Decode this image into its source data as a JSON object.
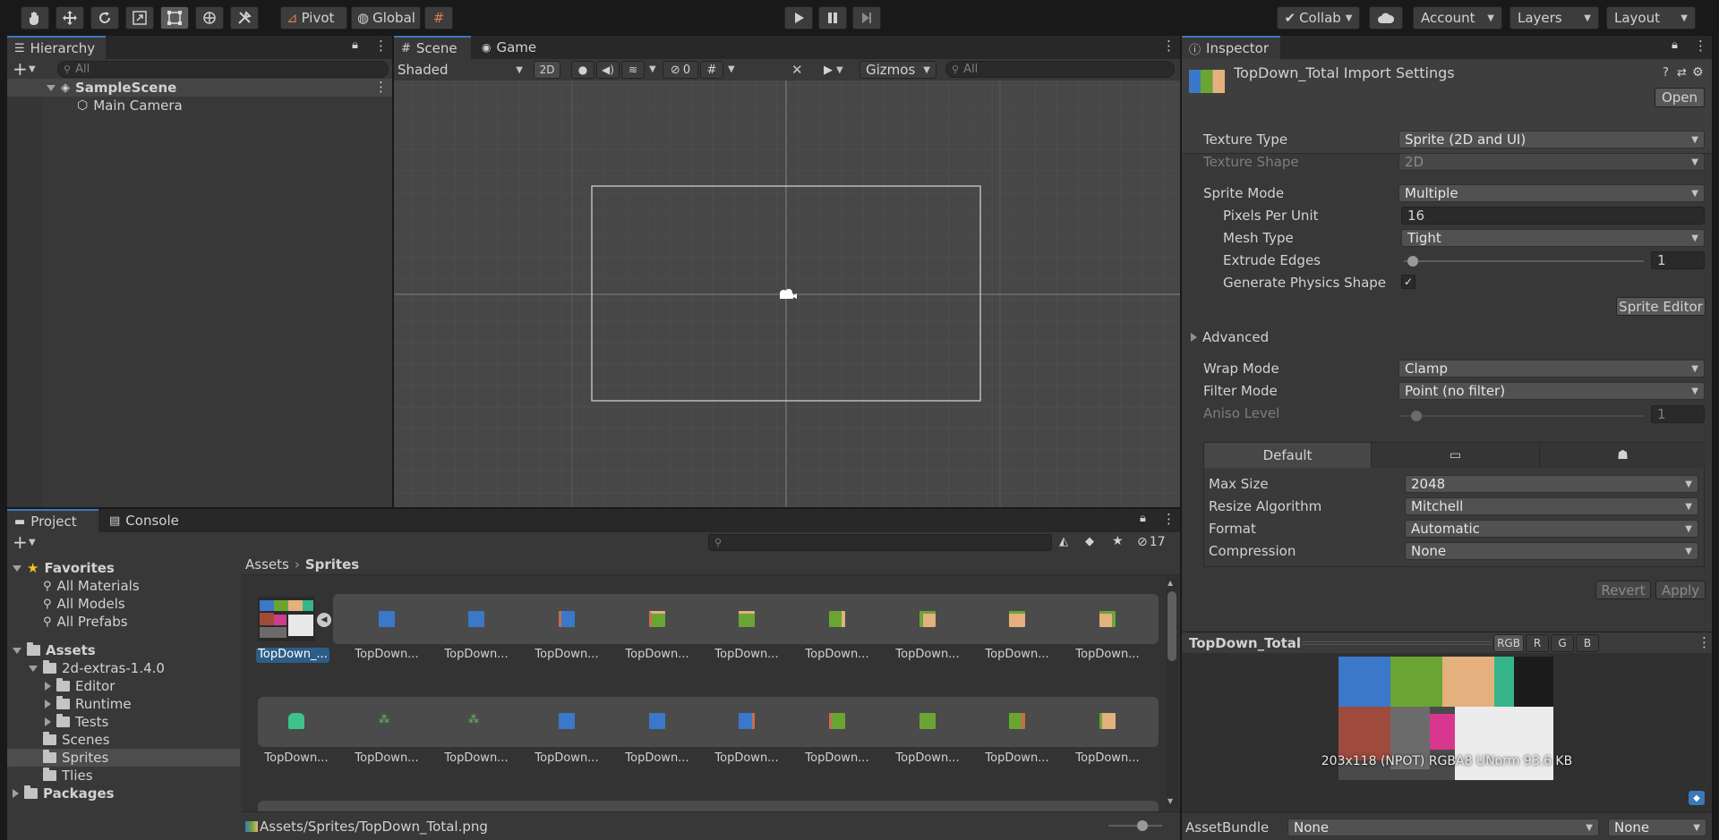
{
  "toolbar": {
    "pivot_label": "Pivot",
    "global_label": "Global",
    "collab_label": "Collab",
    "account_label": "Account",
    "layers_label": "Layers",
    "layout_label": "Layout"
  },
  "hierarchy": {
    "tab_label": "Hierarchy",
    "search_placeholder": "All",
    "scene_name": "SampleScene",
    "items": [
      "Main Camera"
    ]
  },
  "scene_view": {
    "tab_scene": "Scene",
    "tab_game": "Game",
    "shading_mode": "Shaded",
    "mode_2d": "2D",
    "hidden_count": "0",
    "gizmos_label": "Gizmos",
    "search_placeholder": "All"
  },
  "project": {
    "tab_project": "Project",
    "tab_console": "Console",
    "hidden_count": "17",
    "favorites_label": "Favorites",
    "favorites": [
      "All Materials",
      "All Models",
      "All Prefabs"
    ],
    "assets_label": "Assets",
    "folders": [
      "2d-extras-1.4.0",
      "Editor",
      "Runtime",
      "Tests",
      "Scenes",
      "Sprites",
      "Tlies"
    ],
    "packages_label": "Packages",
    "breadcrumb_root": "Assets",
    "breadcrumb_current": "Sprites",
    "selected_asset_label": "TopDown_...",
    "sprite_label": "TopDown...",
    "status_path": "Assets/Sprites/TopDown_Total.png"
  },
  "inspector": {
    "tab_label": "Inspector",
    "title": "TopDown_Total Import Settings",
    "open_label": "Open",
    "texture_type_label": "Texture Type",
    "texture_type_value": "Sprite (2D and UI)",
    "texture_shape_label": "Texture Shape",
    "texture_shape_value": "2D",
    "sprite_mode_label": "Sprite Mode",
    "sprite_mode_value": "Multiple",
    "ppu_label": "Pixels Per Unit",
    "ppu_value": "16",
    "mesh_type_label": "Mesh Type",
    "mesh_type_value": "Tight",
    "extrude_label": "Extrude Edges",
    "extrude_value": "1",
    "gen_physics_label": "Generate Physics Shape",
    "sprite_editor_label": "Sprite Editor",
    "advanced_label": "Advanced",
    "wrap_mode_label": "Wrap Mode",
    "wrap_mode_value": "Clamp",
    "filter_mode_label": "Filter Mode",
    "filter_mode_value": "Point (no filter)",
    "aniso_label": "Aniso Level",
    "aniso_value": "1",
    "platform_default": "Default",
    "max_size_label": "Max Size",
    "max_size_value": "2048",
    "resize_label": "Resize Algorithm",
    "resize_value": "Mitchell",
    "format_label": "Format",
    "format_value": "Automatic",
    "compression_label": "Compression",
    "compression_value": "None",
    "revert_label": "Revert",
    "apply_label": "Apply",
    "preview_title": "TopDown_Total",
    "ch_rgb": "RGB",
    "ch_r": "R",
    "ch_g": "G",
    "ch_b": "B",
    "preview_info": "203x118 (NPOT)  RGBA8 UNorm  93.6 KB",
    "assetbundle_label": "AssetBundle",
    "assetbundle_value": "None",
    "assetbundle_variant": "None"
  },
  "colors": {
    "accent": "#3a79bb",
    "blue_tile": "#3b78c9",
    "green_tile": "#6aa532",
    "sand_tile": "#e3b07e"
  }
}
